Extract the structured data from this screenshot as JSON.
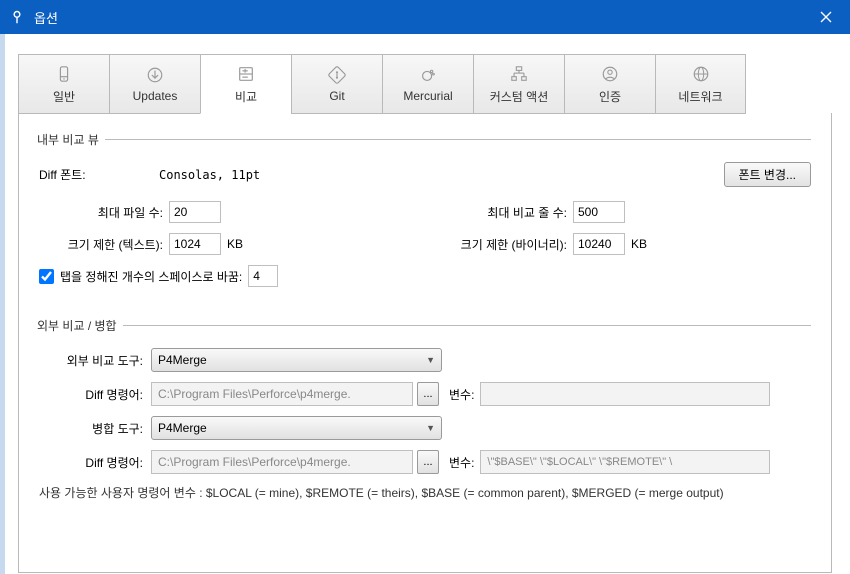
{
  "titlebar": {
    "title": "옵션"
  },
  "tabs": [
    {
      "label": "일반"
    },
    {
      "label": "Updates"
    },
    {
      "label": "비교"
    },
    {
      "label": "Git"
    },
    {
      "label": "Mercurial"
    },
    {
      "label": "커스텀 액션"
    },
    {
      "label": "인증"
    },
    {
      "label": "네트워크"
    }
  ],
  "internal": {
    "legend": "내부 비교 뷰",
    "diffFontLabel": "Diff 폰트:",
    "diffFontValue": "Consolas, 11pt",
    "fontChangeBtn": "폰트 변경...",
    "maxFilesLabel": "최대 파일 수:",
    "maxFilesValue": "20",
    "maxLinesLabel": "최대 비교 줄 수:",
    "maxLinesValue": "500",
    "sizeTextLabel": "크기 제한 (텍스트):",
    "sizeTextValue": "1024",
    "sizeBinLabel": "크기 제한 (바이너리):",
    "sizeBinValue": "10240",
    "kb": "KB",
    "tabsToSpacesLabel": "탭을 정해진 개수의 스페이스로 바꿈:",
    "tabsToSpacesValue": "4"
  },
  "external": {
    "legend": "외부 비교 / 병합",
    "diffToolLabel": "외부 비교 도구:",
    "diffToolValue": "P4Merge",
    "diffCmdLabel": "Diff 명령어:",
    "diffCmdValue": "C:\\Program Files\\Perforce\\p4merge.",
    "argsLabel": "변수:",
    "diffArgsValue": "",
    "mergeToolLabel": "병합 도구:",
    "mergeToolValue": "P4Merge",
    "mergeCmdLabel": "Diff 명령어:",
    "mergeCmdValue": "C:\\Program Files\\Perforce\\p4merge.",
    "mergeArgsValue": "\\\"$BASE\\\" \\\"$LOCAL\\\" \\\"$REMOTE\\\" \\",
    "hint": "사용 가능한 사용자 명령어 변수 : $LOCAL (= mine), $REMOTE (= theirs), $BASE (= common parent), $MERGED (= merge output)",
    "browseBtn": "..."
  }
}
